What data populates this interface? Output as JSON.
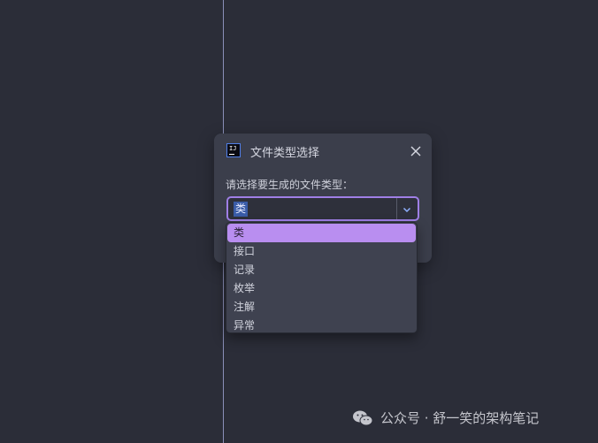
{
  "dialog": {
    "title": "文件类型选择",
    "prompt": "请选择要生成的文件类型：",
    "combo_value": "类",
    "app_icon_text": "IJ"
  },
  "dropdown": {
    "items": [
      "类",
      "接口",
      "记录",
      "枚举",
      "注解",
      "异常"
    ],
    "selected_index": 0
  },
  "watermark": {
    "text": "公众号 · 舒一笑的架构笔记"
  },
  "colors": {
    "background": "#2b2d38",
    "dialog": "#3b3e4b",
    "accent": "#9f7fe6",
    "selected_item": "#b98ef0",
    "text_selection": "#3a5ca8"
  }
}
